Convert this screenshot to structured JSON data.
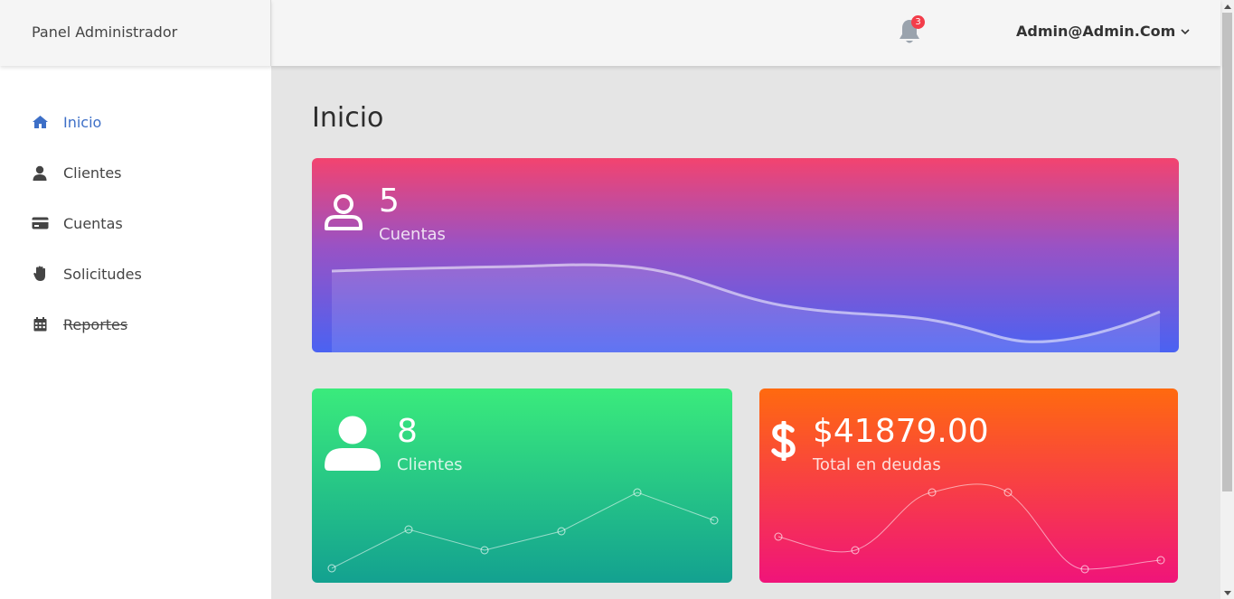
{
  "brand": {
    "title": "Panel Administrador"
  },
  "header": {
    "notifications_count": "3",
    "user_label": "Admin@Admin.Com"
  },
  "sidebar": {
    "items": [
      {
        "label": "Inicio",
        "icon": "home-icon",
        "active": true
      },
      {
        "label": "Clientes",
        "icon": "user-icon"
      },
      {
        "label": "Cuentas",
        "icon": "credit-card-icon"
      },
      {
        "label": "Solicitudes",
        "icon": "hand-icon"
      },
      {
        "label": "Reportes",
        "icon": "calendar-icon",
        "strikethrough": true
      }
    ]
  },
  "main": {
    "title": "Inicio"
  },
  "cards": {
    "cuentas": {
      "value": "5",
      "caption": "Cuentas",
      "icon": "user-outline-icon"
    },
    "clientes": {
      "value": "8",
      "caption": "Clientes",
      "icon": "user-solid-icon"
    },
    "deudas": {
      "value": "$41879.00",
      "caption": "Total en deudas",
      "icon": "dollar-icon"
    }
  },
  "colors": {
    "accent": "#3d6fc7",
    "cuentas_gradient": [
      "#f3436f",
      "#9a52c4",
      "#4a62f2"
    ],
    "clientes_gradient": [
      "#3aeb7c",
      "#13a190"
    ],
    "deudas_gradient": [
      "#ff6a0f",
      "#f0147a"
    ],
    "badge": "#f33d4a"
  }
}
